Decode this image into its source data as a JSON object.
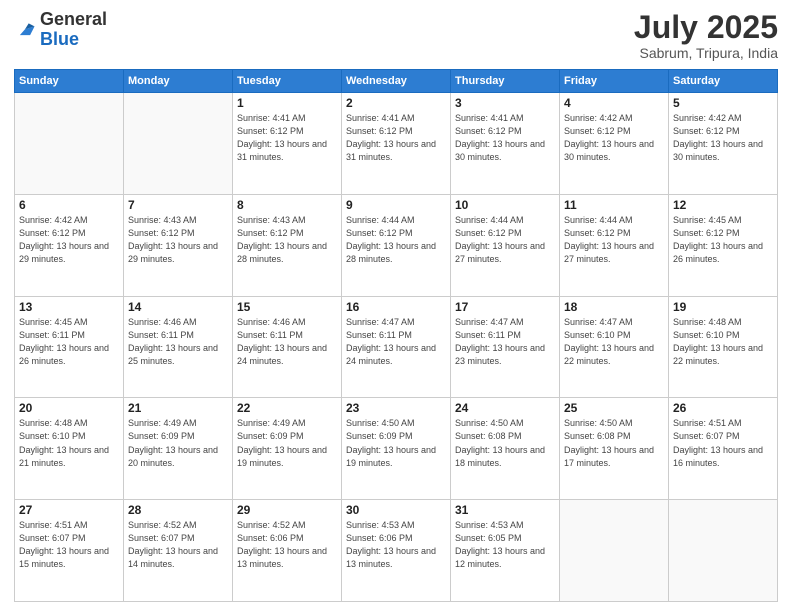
{
  "logo": {
    "general": "General",
    "blue": "Blue"
  },
  "header": {
    "month": "July 2025",
    "location": "Sabrum, Tripura, India"
  },
  "days_of_week": [
    "Sunday",
    "Monday",
    "Tuesday",
    "Wednesday",
    "Thursday",
    "Friday",
    "Saturday"
  ],
  "weeks": [
    [
      {
        "day": "",
        "info": ""
      },
      {
        "day": "",
        "info": ""
      },
      {
        "day": "1",
        "info": "Sunrise: 4:41 AM\nSunset: 6:12 PM\nDaylight: 13 hours and 31 minutes."
      },
      {
        "day": "2",
        "info": "Sunrise: 4:41 AM\nSunset: 6:12 PM\nDaylight: 13 hours and 31 minutes."
      },
      {
        "day": "3",
        "info": "Sunrise: 4:41 AM\nSunset: 6:12 PM\nDaylight: 13 hours and 30 minutes."
      },
      {
        "day": "4",
        "info": "Sunrise: 4:42 AM\nSunset: 6:12 PM\nDaylight: 13 hours and 30 minutes."
      },
      {
        "day": "5",
        "info": "Sunrise: 4:42 AM\nSunset: 6:12 PM\nDaylight: 13 hours and 30 minutes."
      }
    ],
    [
      {
        "day": "6",
        "info": "Sunrise: 4:42 AM\nSunset: 6:12 PM\nDaylight: 13 hours and 29 minutes."
      },
      {
        "day": "7",
        "info": "Sunrise: 4:43 AM\nSunset: 6:12 PM\nDaylight: 13 hours and 29 minutes."
      },
      {
        "day": "8",
        "info": "Sunrise: 4:43 AM\nSunset: 6:12 PM\nDaylight: 13 hours and 28 minutes."
      },
      {
        "day": "9",
        "info": "Sunrise: 4:44 AM\nSunset: 6:12 PM\nDaylight: 13 hours and 28 minutes."
      },
      {
        "day": "10",
        "info": "Sunrise: 4:44 AM\nSunset: 6:12 PM\nDaylight: 13 hours and 27 minutes."
      },
      {
        "day": "11",
        "info": "Sunrise: 4:44 AM\nSunset: 6:12 PM\nDaylight: 13 hours and 27 minutes."
      },
      {
        "day": "12",
        "info": "Sunrise: 4:45 AM\nSunset: 6:12 PM\nDaylight: 13 hours and 26 minutes."
      }
    ],
    [
      {
        "day": "13",
        "info": "Sunrise: 4:45 AM\nSunset: 6:11 PM\nDaylight: 13 hours and 26 minutes."
      },
      {
        "day": "14",
        "info": "Sunrise: 4:46 AM\nSunset: 6:11 PM\nDaylight: 13 hours and 25 minutes."
      },
      {
        "day": "15",
        "info": "Sunrise: 4:46 AM\nSunset: 6:11 PM\nDaylight: 13 hours and 24 minutes."
      },
      {
        "day": "16",
        "info": "Sunrise: 4:47 AM\nSunset: 6:11 PM\nDaylight: 13 hours and 24 minutes."
      },
      {
        "day": "17",
        "info": "Sunrise: 4:47 AM\nSunset: 6:11 PM\nDaylight: 13 hours and 23 minutes."
      },
      {
        "day": "18",
        "info": "Sunrise: 4:47 AM\nSunset: 6:10 PM\nDaylight: 13 hours and 22 minutes."
      },
      {
        "day": "19",
        "info": "Sunrise: 4:48 AM\nSunset: 6:10 PM\nDaylight: 13 hours and 22 minutes."
      }
    ],
    [
      {
        "day": "20",
        "info": "Sunrise: 4:48 AM\nSunset: 6:10 PM\nDaylight: 13 hours and 21 minutes."
      },
      {
        "day": "21",
        "info": "Sunrise: 4:49 AM\nSunset: 6:09 PM\nDaylight: 13 hours and 20 minutes."
      },
      {
        "day": "22",
        "info": "Sunrise: 4:49 AM\nSunset: 6:09 PM\nDaylight: 13 hours and 19 minutes."
      },
      {
        "day": "23",
        "info": "Sunrise: 4:50 AM\nSunset: 6:09 PM\nDaylight: 13 hours and 19 minutes."
      },
      {
        "day": "24",
        "info": "Sunrise: 4:50 AM\nSunset: 6:08 PM\nDaylight: 13 hours and 18 minutes."
      },
      {
        "day": "25",
        "info": "Sunrise: 4:50 AM\nSunset: 6:08 PM\nDaylight: 13 hours and 17 minutes."
      },
      {
        "day": "26",
        "info": "Sunrise: 4:51 AM\nSunset: 6:07 PM\nDaylight: 13 hours and 16 minutes."
      }
    ],
    [
      {
        "day": "27",
        "info": "Sunrise: 4:51 AM\nSunset: 6:07 PM\nDaylight: 13 hours and 15 minutes."
      },
      {
        "day": "28",
        "info": "Sunrise: 4:52 AM\nSunset: 6:07 PM\nDaylight: 13 hours and 14 minutes."
      },
      {
        "day": "29",
        "info": "Sunrise: 4:52 AM\nSunset: 6:06 PM\nDaylight: 13 hours and 13 minutes."
      },
      {
        "day": "30",
        "info": "Sunrise: 4:53 AM\nSunset: 6:06 PM\nDaylight: 13 hours and 13 minutes."
      },
      {
        "day": "31",
        "info": "Sunrise: 4:53 AM\nSunset: 6:05 PM\nDaylight: 13 hours and 12 minutes."
      },
      {
        "day": "",
        "info": ""
      },
      {
        "day": "",
        "info": ""
      }
    ]
  ]
}
